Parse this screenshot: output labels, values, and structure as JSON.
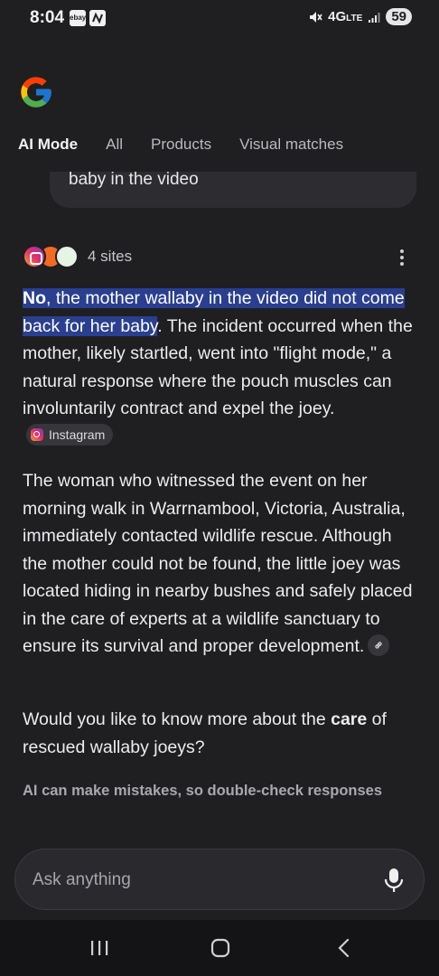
{
  "status_bar": {
    "time": "8:04",
    "app_icon_1": "ebay",
    "app_icon_2": "stylized-n",
    "network": "4G",
    "network_suffix": "LTE",
    "battery": "59",
    "icons": [
      "mute-icon",
      "signal-icon",
      "battery-icon"
    ]
  },
  "tabs": [
    {
      "label": "AI Mode",
      "active": true
    },
    {
      "label": "All",
      "active": false
    },
    {
      "label": "Products",
      "active": false
    },
    {
      "label": "Visual matches",
      "active": false
    }
  ],
  "query": {
    "text": "baby in the video"
  },
  "sources": {
    "count_label": "4 sites"
  },
  "answer": {
    "p1_highlight_bold": "No",
    "p1_highlight_rest": ", the mother wallaby in the video did not come back for her baby",
    "p1_rest": ". The incident occurred when the mother, likely startled, went into \"flight mode,\" a natural response where the pouch muscles can involuntarily contract and expel the joey.",
    "p1_chip": "Instagram",
    "p2": "The woman who witnessed the event on her morning walk in Warrnambool, Victoria, Australia, immediately contacted wildlife rescue. Although the mother could not be found, the little joey was located hiding in nearby bushes and safely placed in the care of experts at a wildlife sanctuary to ensure its survival and proper development.",
    "p3_before": "Would you like to know more about the ",
    "p3_bold": "care",
    "p3_after": " of rescued wallaby joeys?",
    "disclaimer": "AI can make mistakes, so double-check responses"
  },
  "ask_bar": {
    "placeholder": "Ask anything"
  },
  "colors": {
    "background": "#1f1f22",
    "highlight": "#2a3f8f",
    "chip": "#36363b"
  }
}
